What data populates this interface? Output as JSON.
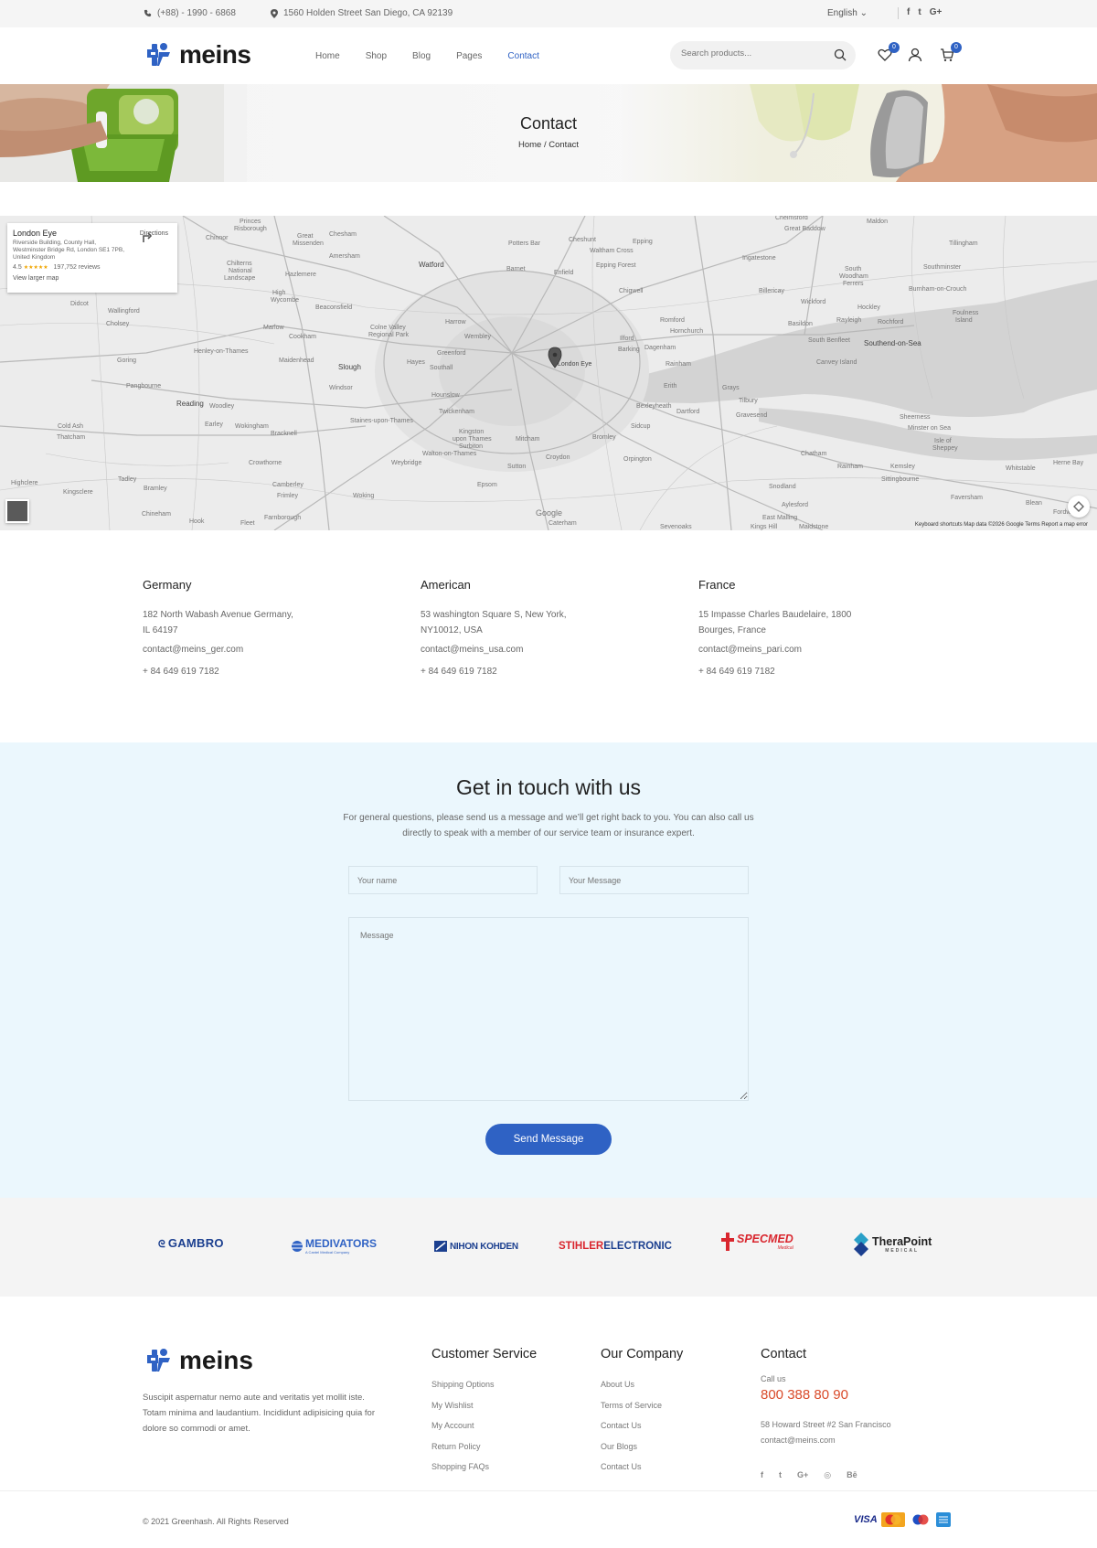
{
  "topbar": {
    "phone": "(+88) - 1990 - 6868",
    "address": "1560 Holden Street San Diego, CA 92139",
    "language": "English",
    "social": [
      "f",
      "t",
      "G+"
    ]
  },
  "header": {
    "logo_text": "meins",
    "nav": [
      {
        "label": "Home",
        "active": false
      },
      {
        "label": "Shop",
        "active": false
      },
      {
        "label": "Blog",
        "active": false
      },
      {
        "label": "Pages",
        "active": false
      },
      {
        "label": "Contact",
        "active": true
      }
    ],
    "search_placeholder": "Search products...",
    "wishlist_count": "0",
    "cart_count": "0"
  },
  "banner": {
    "title": "Contact",
    "crumb_home": "Home",
    "crumb_sep": "/",
    "crumb_current": "Contact"
  },
  "map": {
    "card_title": "London Eye",
    "card_address": "Riverside Building, County Hall, Westminster Bridge Rd, London SE1 7PB, United Kingdom",
    "rating": "4.5",
    "stars": "★★★★★",
    "reviews": "197,752 reviews",
    "larger_map": "View larger map",
    "directions": "Directions",
    "pin_label": "London Eye",
    "footer": "Keyboard shortcuts   Map data ©2026 Google   Terms   Report a map error",
    "places": [
      "Princes Risborough",
      "Chinnor",
      "Great Missenden",
      "Chesham",
      "Amersham",
      "Potters Bar",
      "Cheshunt",
      "Waltham Cross",
      "Epping",
      "Chelmsford",
      "Great Baddow",
      "Maldon",
      "Tillingham",
      "Watford",
      "Barnet",
      "Enfield",
      "Epping Forest",
      "Ingatestone",
      "Chilterns National Landscape",
      "Hazlemere",
      "High Wycombe",
      "Southminster",
      "Didcot",
      "Beaconsfield",
      "Chigwell",
      "Billericay",
      "South Woodham Ferrers",
      "Burnham-on-Crouch",
      "Wallingford",
      "Cholsey",
      "Marlow",
      "Colne Valley Regional Park",
      "Harrow",
      "Romford",
      "Wickford",
      "Hockley",
      "Foulness Island",
      "Cookham",
      "Wembley",
      "Hornchurch",
      "Basildon",
      "Rayleigh",
      "Rochford",
      "Henley-on-Thames",
      "Maidenhead",
      "Greenford",
      "Ilford",
      "Barking",
      "Dagenham",
      "South Benfleet",
      "Southend-on-Sea",
      "Goring",
      "Slough",
      "Hayes",
      "Southall",
      "London Eye",
      "Rainham",
      "Canvey Island",
      "Pangbourne",
      "Windsor",
      "Hounslow",
      "Erith",
      "Grays",
      "Reading",
      "Woodley",
      "Twickenham",
      "Bexleyheath",
      "Dartford",
      "Tilbury",
      "Earley",
      "Wokingham",
      "Bracknell",
      "Staines-upon-Thames",
      "Kingston upon Thames",
      "Sidcup",
      "Gravesend",
      "Sheerness",
      "Minster on Sea",
      "Cold Ash",
      "Thatcham",
      "Mitcham",
      "Bromley",
      "Isle of Sheppey",
      "Surbiton",
      "Walton-on-Thames",
      "Weybridge",
      "Croydon",
      "Orpington",
      "Chatham",
      "Rainham",
      "Kemsley",
      "Whitstable",
      "Herne Bay",
      "Crowthorne",
      "Sutton",
      "Sittingbourne",
      "Highclere",
      "Tadley",
      "Camberley",
      "Epsom",
      "Kingsclere",
      "Bramley",
      "Frimley",
      "Woking",
      "Snodland",
      "Faversham",
      "Blean",
      "Fordwich",
      "Chineham",
      "Hook",
      "Fleet",
      "Farnborough",
      "Caterham",
      "Sevenoaks",
      "Kings Hill",
      "Maidstone",
      "East Malling",
      "Aylesford"
    ]
  },
  "offices": [
    {
      "name": "Germany",
      "address1": "182 North Wabash Avenue Germany,",
      "address2": "IL 64197",
      "email": "contact@meins_ger.com",
      "phone": "+ 84 649 619 7182"
    },
    {
      "name": "American",
      "address1": "53 washington Square S, New York,",
      "address2": "NY10012, USA",
      "email": "contact@meins_usa.com",
      "phone": "+ 84 649 619 7182"
    },
    {
      "name": "France",
      "address1": "15 Impasse Charles Baudelaire, 1800",
      "address2": "Bourges, France",
      "email": "contact@meins_pari.com",
      "phone": "+ 84 649 619 7182"
    }
  ],
  "contact_form": {
    "title": "Get in touch with us",
    "desc": "For general questions, please send us a message and we’ll get right back to you. You can also call us directly to speak with a member of our service team or insurance expert.",
    "name_placeholder": "Your name",
    "email_placeholder": "Your Message",
    "message_placeholder": "Message",
    "submit_label": "Send Message"
  },
  "brands": [
    {
      "name": "GAMBRO",
      "color": "#1b3f8f"
    },
    {
      "name": "MEDIVATORS",
      "sub": "A Cantel Medical Company",
      "color": "#2f62c4"
    },
    {
      "name": "NIHON KOHDEN",
      "color": "#1b3f8f"
    },
    {
      "name": "STIHLER",
      "name2": "ELECTRONIC",
      "color": "#d9262e",
      "color2": "#1b3f8f"
    },
    {
      "name": "SPECMED",
      "sub": "Medical",
      "color": "#d9262e"
    },
    {
      "name": "TheraPoint",
      "sub": "MEDICAL",
      "color": "#222222"
    }
  ],
  "footer": {
    "logo_text": "meins",
    "desc": "Suscipit aspernatur nemo aute and veritatis yet mollit iste. Totam minima and laudantium. Incididunt adipisicing quia for dolore so commodi or amet.",
    "customer_service": {
      "title": "Customer Service",
      "links": [
        "Shipping Options",
        "My Wishlist",
        "My Account",
        "Return Policy",
        "Shopping FAQs"
      ]
    },
    "our_company": {
      "title": "Our Company",
      "links": [
        "About Us",
        "Terms of Service",
        "Contact Us",
        "Our Blogs",
        "Contact Us"
      ]
    },
    "contact": {
      "title": "Contact",
      "call_label": "Call us",
      "phone": "800 388 80 90",
      "address": "58 Howard Street #2 San Francisco",
      "email": "contact@meins.com",
      "social": [
        "f",
        "t",
        "G+",
        "◎",
        "Bē"
      ]
    },
    "copyright": "© 2021 Greenhash. All Rights Reserved",
    "payments": [
      "VISA",
      "MasterCard",
      "Maestro",
      "AMEX"
    ]
  },
  "colors": {
    "accent": "#2f62c4",
    "phone": "#d94b2a",
    "form_bg": "#ebf7fd"
  }
}
